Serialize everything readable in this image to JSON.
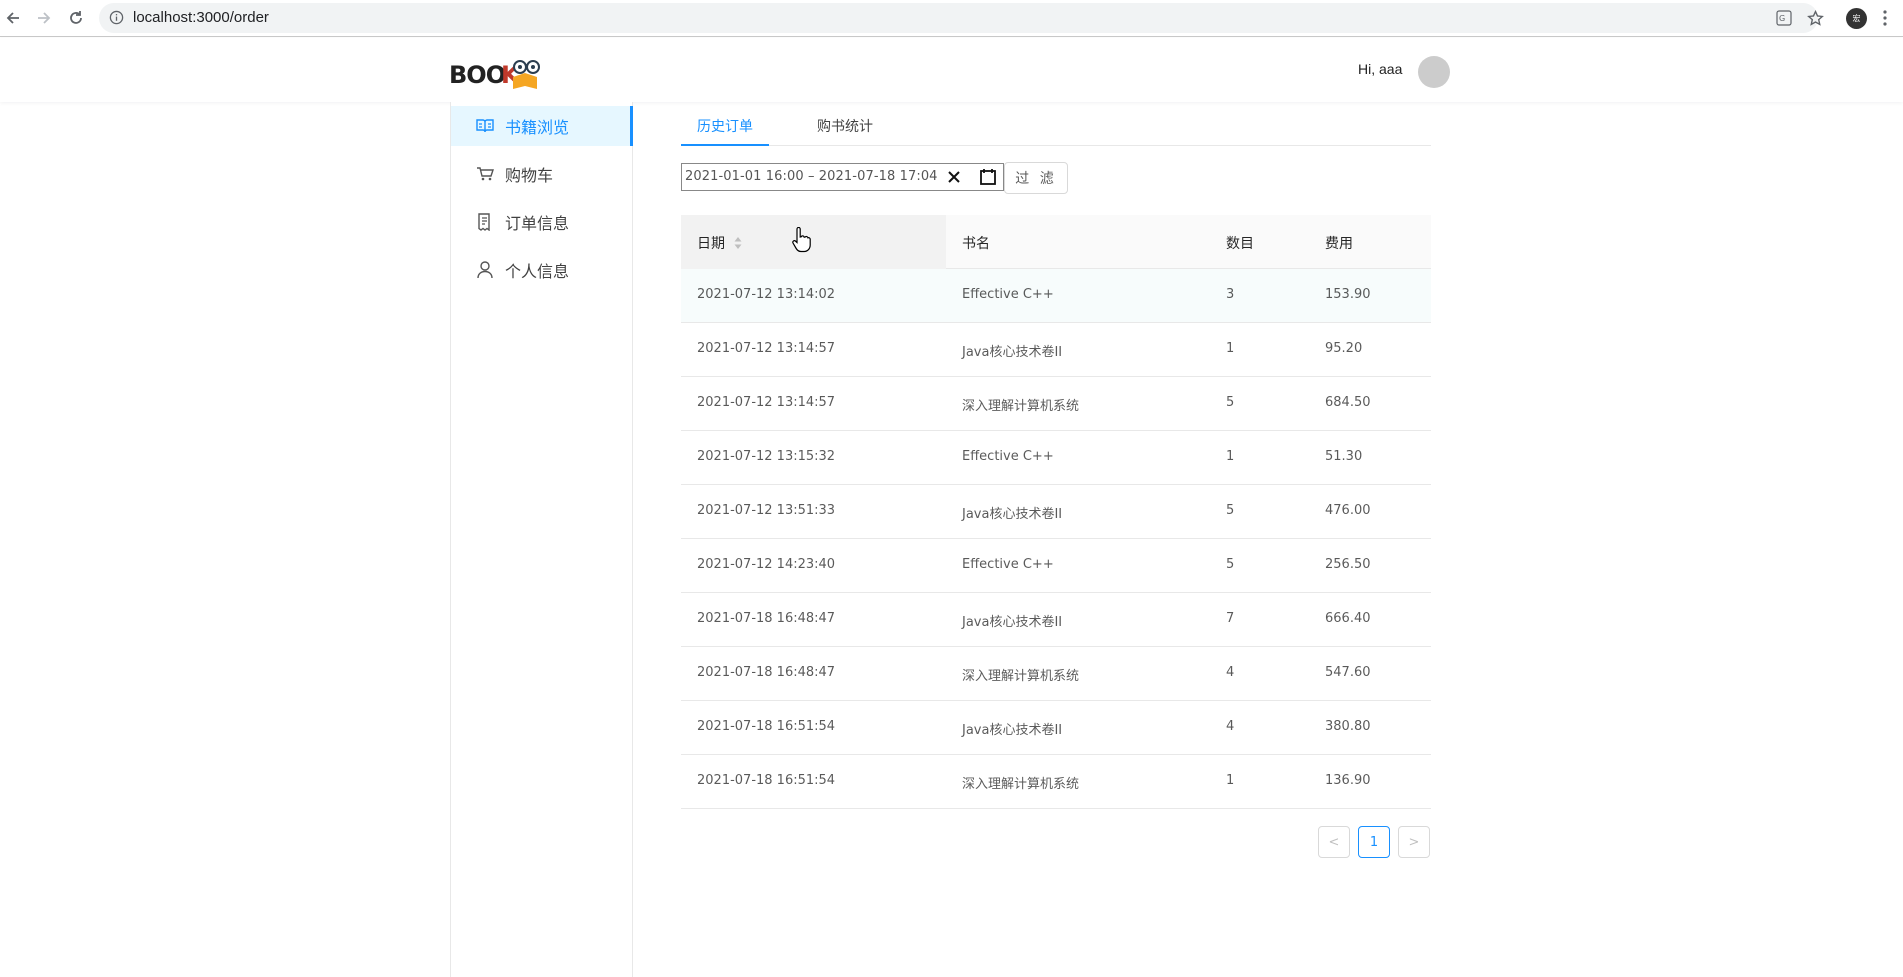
{
  "browser": {
    "url": "localhost:3000/order",
    "profile_initial": "宏"
  },
  "header": {
    "logo_text": "BOOK",
    "greeting": "Hi, aaa"
  },
  "sidebar": {
    "items": [
      {
        "label": "书籍浏览",
        "icon": "book-open-icon"
      },
      {
        "label": "购物车",
        "icon": "shopping-cart-icon"
      },
      {
        "label": "订单信息",
        "icon": "order-receipt-icon"
      },
      {
        "label": "个人信息",
        "icon": "user-icon"
      }
    ]
  },
  "tabs": [
    {
      "label": "历史订单",
      "active": true
    },
    {
      "label": "购书统计",
      "active": false
    }
  ],
  "filter": {
    "date_range": "2021-01-01  16:00 – 2021-07-18  17:04",
    "button_label": "过 滤"
  },
  "table": {
    "columns": [
      "日期",
      "书名",
      "数目",
      "费用"
    ],
    "rows": [
      [
        "2021-07-12 13:14:02",
        "Effective C++",
        "3",
        "153.90"
      ],
      [
        "2021-07-12 13:14:57",
        "Java核心技术卷II",
        "1",
        "95.20"
      ],
      [
        "2021-07-12 13:14:57",
        "深入理解计算机系统",
        "5",
        "684.50"
      ],
      [
        "2021-07-12 13:15:32",
        "Effective C++",
        "1",
        "51.30"
      ],
      [
        "2021-07-12 13:51:33",
        "Java核心技术卷II",
        "5",
        "476.00"
      ],
      [
        "2021-07-12 14:23:40",
        "Effective C++",
        "5",
        "256.50"
      ],
      [
        "2021-07-18 16:48:47",
        "Java核心技术卷II",
        "7",
        "666.40"
      ],
      [
        "2021-07-18 16:48:47",
        "深入理解计算机系统",
        "4",
        "547.60"
      ],
      [
        "2021-07-18 16:51:54",
        "Java核心技术卷II",
        "4",
        "380.80"
      ],
      [
        "2021-07-18 16:51:54",
        "深入理解计算机系统",
        "1",
        "136.90"
      ]
    ]
  },
  "pagination": {
    "prev": "<",
    "current": "1",
    "next": ">"
  },
  "colors": {
    "accent": "#1890ff",
    "active_bg": "#e6f7ff"
  }
}
